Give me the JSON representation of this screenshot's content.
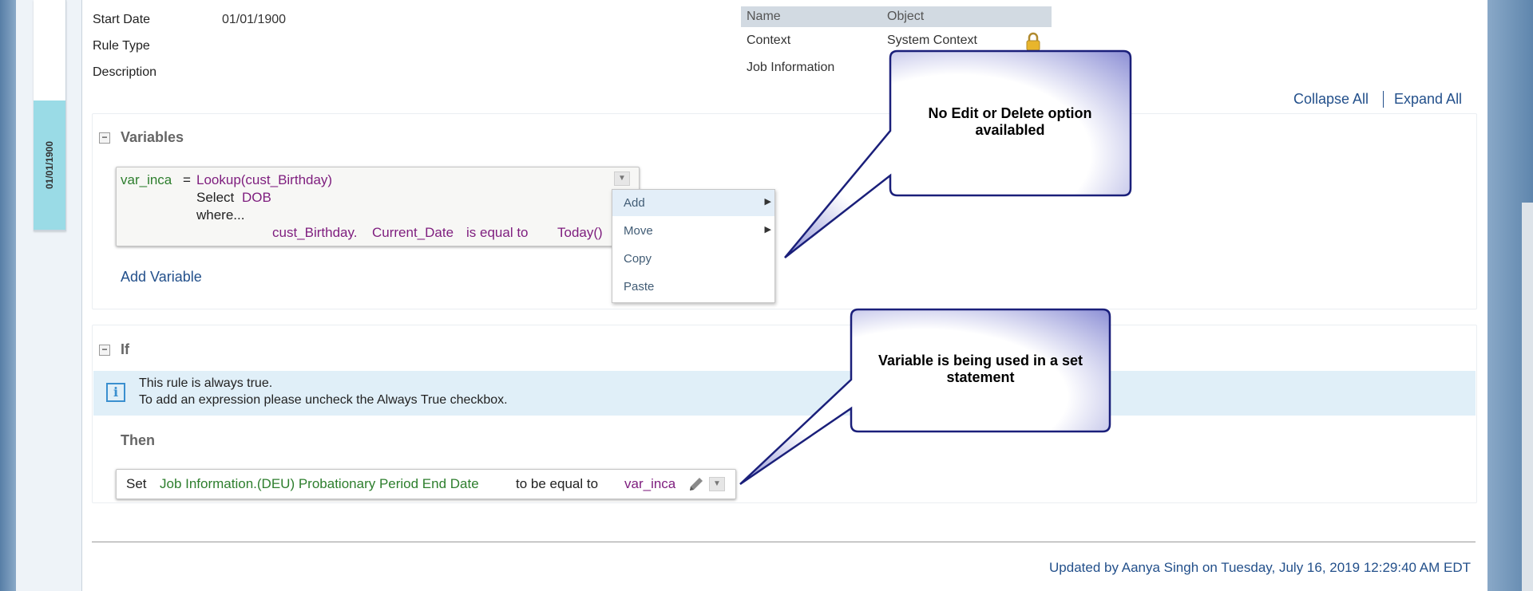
{
  "sidebar": {
    "tab_date": "01/01/1900"
  },
  "details": {
    "start_date_label": "Start Date",
    "start_date_value": "01/01/1900",
    "rule_type_label": "Rule Type",
    "description_label": "Description"
  },
  "parameters": {
    "headers": {
      "name": "Name",
      "object": "Object"
    },
    "rows": [
      {
        "name": "Context",
        "object": "System Context"
      },
      {
        "name": "Job Information",
        "object": ""
      }
    ]
  },
  "toolbar": {
    "collapse_all": "Collapse All",
    "expand_all": "Expand All"
  },
  "variables": {
    "title": "Variables",
    "var_name": "var_inca",
    "equals": "=",
    "lookup": "Lookup(cust_Birthday)",
    "select_kw": "Select",
    "select_field": "DOB",
    "where_kw": "where...",
    "cond_obj": "cust_Birthday.",
    "cond_field": "Current_Date",
    "cond_op": "is equal to",
    "cond_value": "Today()",
    "add_variable": "Add Variable"
  },
  "context_menu": {
    "items": [
      {
        "label": "Add",
        "submenu": true
      },
      {
        "label": "Move",
        "submenu": true
      },
      {
        "label": "Copy",
        "submenu": false
      },
      {
        "label": "Paste",
        "submenu": false
      }
    ]
  },
  "if_section": {
    "title": "If",
    "info_line1": "This rule is always true.",
    "info_line2": "To add an expression please uncheck the Always True checkbox.",
    "then_label": "Then"
  },
  "set_statement": {
    "set_kw": "Set",
    "target": "Job Information.(DEU) Probationary Period End Date",
    "op": "to be equal to",
    "value": "var_inca"
  },
  "callouts": {
    "top": "No Edit or Delete option availabled",
    "bottom": "Variable is being used in a set statement"
  },
  "footer": {
    "updated": "Updated by Aanya Singh on Tuesday, July 16, 2019 12:29:40 AM EDT"
  },
  "colors": {
    "accent": "#23508b",
    "variable": "#2d7e2d",
    "function": "#7e1d7e",
    "callout_border": "#1a1f7a"
  }
}
